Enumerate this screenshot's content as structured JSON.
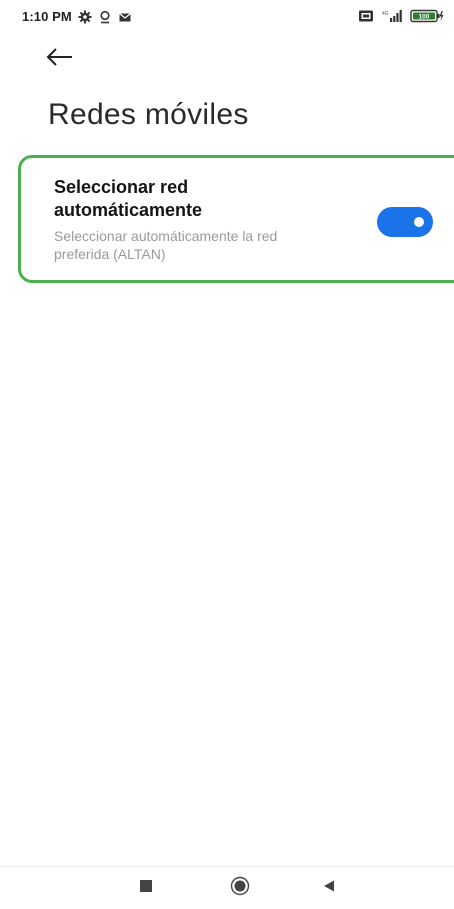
{
  "status_bar": {
    "time": "1:10 PM",
    "battery_level": "100"
  },
  "header": {
    "title": "Redes móviles"
  },
  "setting": {
    "title_line1": "Seleccionar red",
    "title_line2": "automáticamente",
    "description_line1": "Seleccionar automáticamente la red",
    "description_line2": "preferida (ALTAN)",
    "enabled": true
  },
  "colors": {
    "accent": "#1a73e8",
    "highlight_border": "#4caf50",
    "description_text": "#9a9a9a"
  }
}
